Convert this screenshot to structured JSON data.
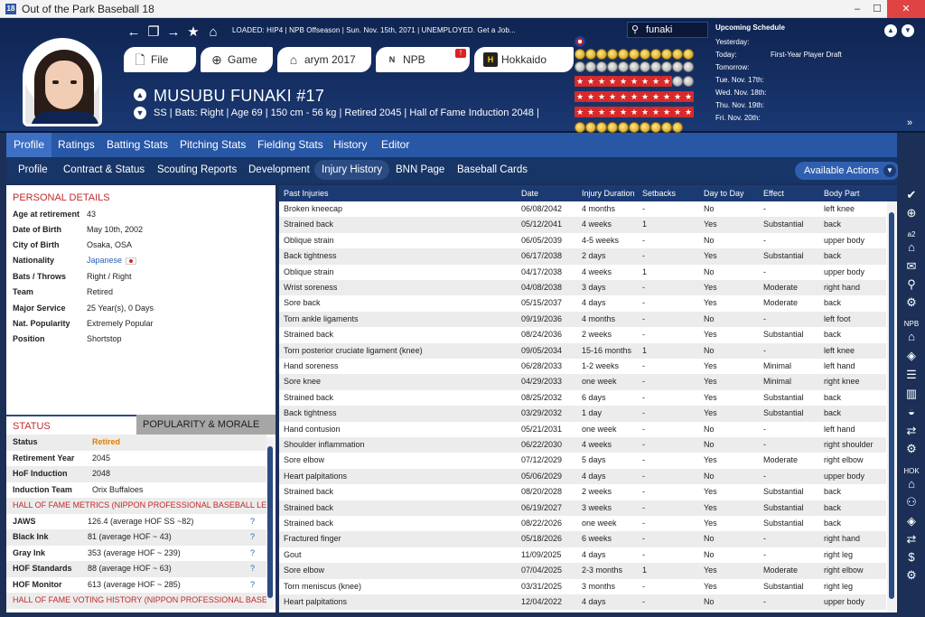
{
  "window": {
    "title": "Out of the Park Baseball 18",
    "minimize": "–",
    "maximize": "☐",
    "close": "✕"
  },
  "header": {
    "nav_icons": [
      "back-arrow-icon",
      "pages-icon",
      "forward-arrow-icon",
      "star-icon",
      "home-icon"
    ],
    "status_line": "LOADED: HIP4  |  NPB Offseason  |  Sun. Nov. 15th, 2071  |  UNEMPLOYED. Get a Job...",
    "buttons": [
      {
        "label": "File",
        "icon": "file-icon"
      },
      {
        "label": "Game",
        "icon": "globe-icon"
      },
      {
        "label": "arym 2017",
        "icon": "home-icon"
      },
      {
        "label": "NPB",
        "icon": "npb-logo-icon",
        "badge": "!"
      },
      {
        "label": "Hokkaido Nip...",
        "icon": "hokkaido-logo-icon"
      }
    ],
    "search": {
      "value": "funaki"
    },
    "player": {
      "name": "MUSUBU FUNAKI  #17",
      "info": "SS | Bats: Right  |  Age 69  |  150 cm - 56 kg  |  Retired 2045  |  Hall of Fame Induction 2048  |"
    },
    "schedule": {
      "title": "Upcoming Schedule",
      "rows": [
        {
          "day": "Yesterday:",
          "event": ""
        },
        {
          "day": "Today:",
          "event": "First-Year Player Draft"
        },
        {
          "day": "Tomorrow:",
          "event": ""
        },
        {
          "day": "Tue. Nov. 17th:",
          "event": ""
        },
        {
          "day": "Wed. Nov. 18th:",
          "event": ""
        },
        {
          "day": "Thu. Nov. 19th:",
          "event": ""
        },
        {
          "day": "Fri. Nov. 20th:",
          "event": ""
        }
      ]
    }
  },
  "tabs_primary": [
    "Profile",
    "Ratings",
    "Batting Stats",
    "Pitching Stats",
    "Fielding Stats",
    "History",
    "Editor"
  ],
  "tabs_secondary": [
    "Profile",
    "Contract & Status",
    "Scouting Reports",
    "Development",
    "Injury History",
    "BNN Page",
    "Baseball Cards"
  ],
  "available_actions": "Available Actions",
  "personal_details": {
    "title": "PERSONAL DETAILS",
    "rows": [
      {
        "label": "Age at retirement",
        "value": "43"
      },
      {
        "label": "Date of Birth",
        "value": "May 10th, 2002"
      },
      {
        "label": "City of Birth",
        "value": "Osaka, OSA"
      },
      {
        "label": "Nationality",
        "value": "Japanese"
      },
      {
        "label": "Bats / Throws",
        "value": "Right / Right"
      },
      {
        "label": "Team",
        "value": "Retired"
      },
      {
        "label": "Major Service",
        "value": "25 Year(s), 0 Days"
      },
      {
        "label": "Nat. Popularity",
        "value": "Extremely Popular"
      },
      {
        "label": "Position",
        "value": "Shortstop"
      }
    ]
  },
  "status_tabs": [
    "STATUS",
    "POPULARITY & MORALE"
  ],
  "status": {
    "rows": [
      {
        "label": "Status",
        "value": "Retired"
      },
      {
        "label": "Retirement Year",
        "value": "2045"
      },
      {
        "label": "HoF Induction",
        "value": "2048"
      },
      {
        "label": "Induction Team",
        "value": "Orix Buffaloes"
      }
    ],
    "hof_metrics_title": "HALL OF FAME METRICS (NIPPON PROFESSIONAL BASEBALL LEA",
    "hof_metrics": [
      {
        "label": "JAWS",
        "value": "126.4 (average HOF SS ~82)",
        "help": "?"
      },
      {
        "label": "Black Ink",
        "value": "81 (average HOF ~ 43)",
        "help": "?"
      },
      {
        "label": "Gray Ink",
        "value": "353 (average HOF ~ 239)",
        "help": "?"
      },
      {
        "label": "HOF Standards",
        "value": "88 (average HOF ~ 63)",
        "help": "?"
      },
      {
        "label": "HOF Monitor",
        "value": "613 (average HOF ~ 285)",
        "help": "?"
      }
    ],
    "hof_voting_title": "HALL OF FAME VOTING HISTORY (NIPPON PROFESSIONAL BASEB"
  },
  "injuries": {
    "columns": [
      "Past Injuries",
      "Date",
      "Injury Duration",
      "Setbacks",
      "Day to Day",
      "Effect",
      "Body Part"
    ],
    "rows": [
      [
        "Broken kneecap",
        "06/08/2042",
        "4 months",
        "-",
        "No",
        "-",
        "left knee"
      ],
      [
        "Strained back",
        "05/12/2041",
        "4 weeks",
        "1",
        "Yes",
        "Substantial",
        "back"
      ],
      [
        "Oblique strain",
        "06/05/2039",
        "4-5 weeks",
        "-",
        "No",
        "-",
        "upper body"
      ],
      [
        "Back tightness",
        "06/17/2038",
        "2 days",
        "-",
        "Yes",
        "Substantial",
        "back"
      ],
      [
        "Oblique strain",
        "04/17/2038",
        "4 weeks",
        "1",
        "No",
        "-",
        "upper body"
      ],
      [
        "Wrist soreness",
        "04/08/2038",
        "3 days",
        "-",
        "Yes",
        "Moderate",
        "right hand"
      ],
      [
        "Sore back",
        "05/15/2037",
        "4 days",
        "-",
        "Yes",
        "Moderate",
        "back"
      ],
      [
        "Torn ankle ligaments",
        "09/19/2036",
        "4 months",
        "-",
        "No",
        "-",
        "left foot"
      ],
      [
        "Strained back",
        "08/24/2036",
        "2 weeks",
        "-",
        "Yes",
        "Substantial",
        "back"
      ],
      [
        "Torn posterior cruciate ligament (knee)",
        "09/05/2034",
        "15-16 months",
        "1",
        "No",
        "-",
        "left knee"
      ],
      [
        "Hand soreness",
        "06/28/2033",
        "1-2 weeks",
        "-",
        "Yes",
        "Minimal",
        "left hand"
      ],
      [
        "Sore knee",
        "04/29/2033",
        "one week",
        "-",
        "Yes",
        "Minimal",
        "right knee"
      ],
      [
        "Strained back",
        "08/25/2032",
        "6 days",
        "-",
        "Yes",
        "Substantial",
        "back"
      ],
      [
        "Back tightness",
        "03/29/2032",
        "1 day",
        "-",
        "Yes",
        "Substantial",
        "back"
      ],
      [
        "Hand contusion",
        "05/21/2031",
        "one week",
        "-",
        "No",
        "-",
        "left hand"
      ],
      [
        "Shoulder inflammation",
        "06/22/2030",
        "4 weeks",
        "-",
        "No",
        "-",
        "right shoulder"
      ],
      [
        "Sore elbow",
        "07/12/2029",
        "5 days",
        "-",
        "Yes",
        "Moderate",
        "right elbow"
      ],
      [
        "Heart palpitations",
        "05/06/2029",
        "4 days",
        "-",
        "No",
        "-",
        "upper body"
      ],
      [
        "Strained back",
        "08/20/2028",
        "2 weeks",
        "-",
        "Yes",
        "Substantial",
        "back"
      ],
      [
        "Strained back",
        "06/19/2027",
        "3 weeks",
        "-",
        "Yes",
        "Substantial",
        "back"
      ],
      [
        "Strained back",
        "08/22/2026",
        "one week",
        "-",
        "Yes",
        "Substantial",
        "back"
      ],
      [
        "Fractured finger",
        "05/18/2026",
        "6 weeks",
        "-",
        "No",
        "-",
        "right hand"
      ],
      [
        "Gout",
        "11/09/2025",
        "4 days",
        "-",
        "No",
        "-",
        "right leg"
      ],
      [
        "Sore elbow",
        "07/04/2025",
        "2-3 months",
        "1",
        "Yes",
        "Moderate",
        "right elbow"
      ],
      [
        "Torn meniscus (knee)",
        "03/31/2025",
        "3 months",
        "-",
        "Yes",
        "Substantial",
        "right leg"
      ],
      [
        "Heart palpitations",
        "12/04/2022",
        "4 days",
        "-",
        "No",
        "-",
        "upper body"
      ]
    ]
  },
  "sidebar": {
    "labels": [
      "a2",
      "NPB",
      "HOK"
    ]
  },
  "colors": {
    "header_bg": "#1a3872",
    "tab_bar": "#2857a6",
    "accent_red": "#c02a2a",
    "status_orange": "#e07b00"
  }
}
